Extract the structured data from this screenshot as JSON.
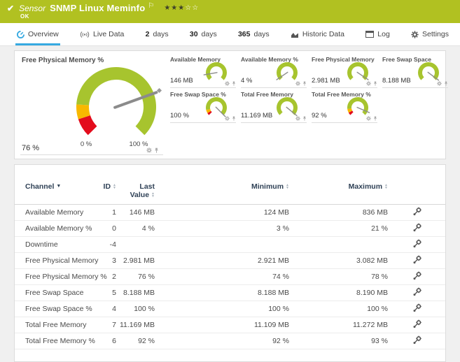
{
  "header": {
    "kind_label": "Sensor",
    "title": "SNMP Linux Meminfo",
    "status": "OK",
    "rating": {
      "filled": 3,
      "total": 5
    }
  },
  "tabs": [
    {
      "id": "overview",
      "label": "Overview",
      "icon": "gauge-icon",
      "active": true
    },
    {
      "id": "live-data",
      "label": "Live Data",
      "icon": "broadcast-icon",
      "active": false
    },
    {
      "id": "2-days",
      "num": "2",
      "label": "days",
      "active": false
    },
    {
      "id": "30-days",
      "num": "30",
      "label": "days",
      "active": false
    },
    {
      "id": "365-days",
      "num": "365",
      "label": "days",
      "active": false
    },
    {
      "id": "historic-data",
      "label": "Historic Data",
      "icon": "chart-icon",
      "active": false
    },
    {
      "id": "log",
      "label": "Log",
      "icon": "log-icon",
      "active": false
    },
    {
      "id": "settings",
      "label": "Settings",
      "icon": "gear-icon",
      "active": false
    }
  ],
  "overview": {
    "big_gauge": {
      "title": "Free Physical Memory %",
      "value": "76 %",
      "scale_min": "0 %",
      "scale_max": "100 %",
      "needle": 0.76,
      "segments": [
        [
          "red",
          0,
          0.1
        ],
        [
          "yellow",
          0.1,
          0.18
        ],
        [
          "green",
          0.18,
          1
        ]
      ]
    },
    "small_gauges": [
      {
        "title": "Available Memory",
        "value": "146 MB",
        "needle": 0.13,
        "segments": [
          [
            "green",
            0,
            1
          ]
        ]
      },
      {
        "title": "Available Memory %",
        "value": "4 %",
        "needle": 0.04,
        "segments": [
          [
            "green",
            0,
            1
          ]
        ]
      },
      {
        "title": "Free Physical Memory",
        "value": "2.981 MB",
        "needle": 0.96,
        "segments": [
          [
            "green",
            0,
            1
          ]
        ]
      },
      {
        "title": "Free Swap Space",
        "value": "8.188 MB",
        "needle": 0.97,
        "segments": [
          [
            "green",
            0,
            1
          ]
        ]
      },
      {
        "title": "Free Swap Space %",
        "value": "100 %",
        "needle": 1.0,
        "segments": [
          [
            "red",
            0,
            0.05
          ],
          [
            "yellow",
            0.05,
            0.12
          ],
          [
            "green",
            0.12,
            1
          ]
        ]
      },
      {
        "title": "Total Free Memory",
        "value": "11.169 MB",
        "needle": 0.98,
        "segments": [
          [
            "green",
            0,
            1
          ]
        ]
      },
      {
        "title": "Total Free Memory %",
        "value": "92 %",
        "needle": 0.92,
        "segments": [
          [
            "red",
            0,
            0.06
          ],
          [
            "yellow",
            0.06,
            0.14
          ],
          [
            "green",
            0.14,
            1
          ]
        ]
      }
    ]
  },
  "chart_data": {
    "type": "gauge-set",
    "gauges": [
      {
        "title": "Free Physical Memory %",
        "value": 76,
        "min": 0,
        "max": 100,
        "unit": "%"
      },
      {
        "title": "Available Memory",
        "value": "146 MB"
      },
      {
        "title": "Available Memory %",
        "value": "4 %"
      },
      {
        "title": "Free Physical Memory",
        "value": "2.981 MB"
      },
      {
        "title": "Free Swap Space",
        "value": "8.188 MB"
      },
      {
        "title": "Free Swap Space %",
        "value": "100 %"
      },
      {
        "title": "Total Free Memory",
        "value": "11.169 MB"
      },
      {
        "title": "Total Free Memory %",
        "value": "92 %"
      }
    ]
  },
  "table": {
    "columns": [
      {
        "label": "Channel",
        "sort": "desc"
      },
      {
        "label": "ID",
        "sort": "both"
      },
      {
        "label": "Last Value",
        "sort": "both",
        "two_line": true
      },
      {
        "label": "Minimum",
        "sort": "both"
      },
      {
        "label": "Maximum",
        "sort": "both"
      },
      {
        "label": "",
        "sort": "none"
      }
    ],
    "rows": [
      {
        "channel": "Available Memory",
        "id": "1",
        "last": "146 MB",
        "min": "124 MB",
        "max": "836 MB"
      },
      {
        "channel": "Available Memory %",
        "id": "0",
        "last": "4 %",
        "min": "3 %",
        "max": "21 %"
      },
      {
        "channel": "Downtime",
        "id": "-4",
        "last": "",
        "min": "",
        "max": ""
      },
      {
        "channel": "Free Physical Memory",
        "id": "3",
        "last": "2.981 MB",
        "min": "2.921 MB",
        "max": "3.082 MB"
      },
      {
        "channel": "Free Physical Memory %",
        "id": "2",
        "last": "76 %",
        "min": "74 %",
        "max": "78 %"
      },
      {
        "channel": "Free Swap Space",
        "id": "5",
        "last": "8.188 MB",
        "min": "8.188 MB",
        "max": "8.190 MB"
      },
      {
        "channel": "Free Swap Space %",
        "id": "4",
        "last": "100 %",
        "min": "100 %",
        "max": "100 %"
      },
      {
        "channel": "Total Free Memory",
        "id": "7",
        "last": "11.169 MB",
        "min": "11.109 MB",
        "max": "11.272 MB"
      },
      {
        "channel": "Total Free Memory %",
        "id": "6",
        "last": "92 %",
        "min": "92 %",
        "max": "93 %"
      }
    ]
  },
  "colors": {
    "status_green": "#b1c121",
    "accent_blue": "#36a9e1",
    "gauge_green": "#a7c42e",
    "gauge_yellow": "#f8b800",
    "gauge_red": "#e30c1c",
    "needle_gray": "#8b8b8b",
    "table_header_text": "#2f4156"
  }
}
